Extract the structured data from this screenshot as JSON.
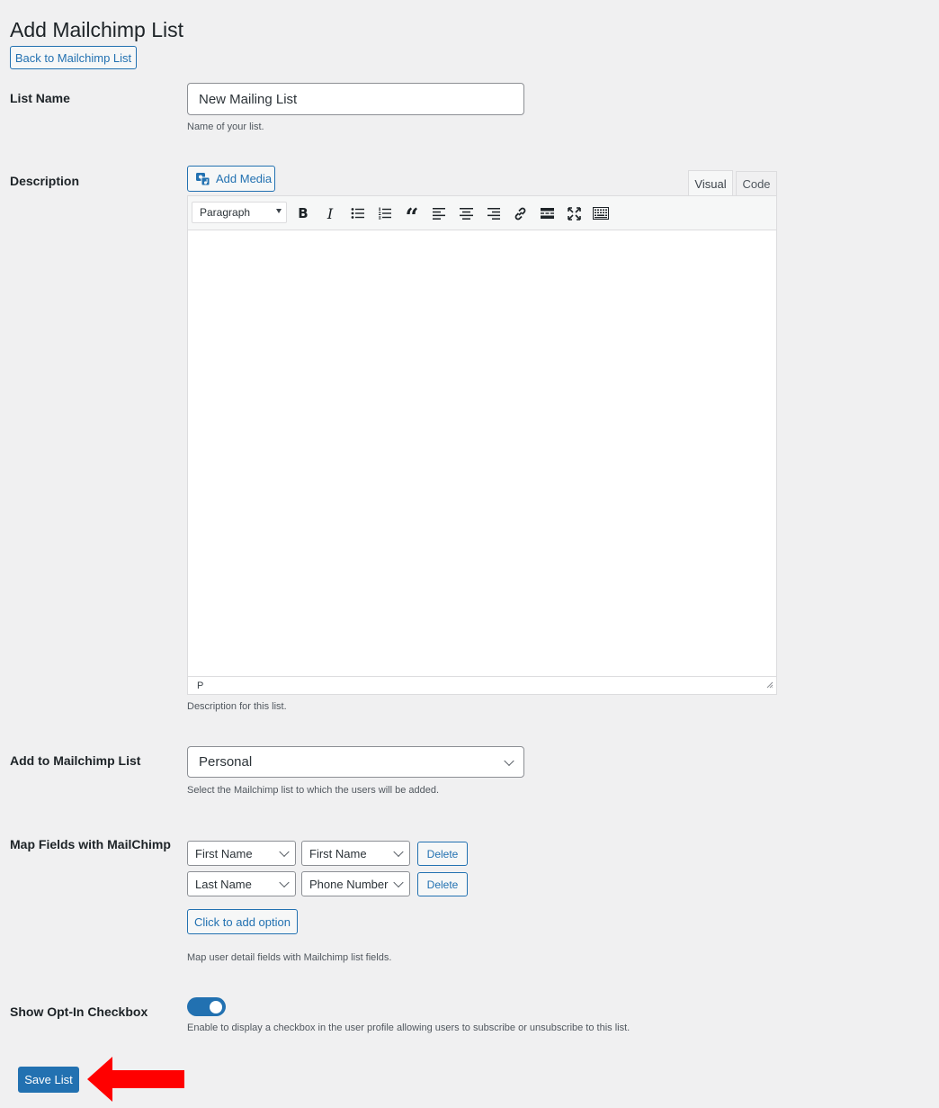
{
  "page": {
    "title": "Add Mailchimp List",
    "back_button": "Back to Mailchimp List"
  },
  "list_name": {
    "label": "List Name",
    "value": "New Mailing List",
    "help": "Name of your list."
  },
  "description": {
    "label": "Description",
    "add_media": "Add Media",
    "tabs": [
      "Visual",
      "Code"
    ],
    "active_tab": "Visual",
    "format_select": "Paragraph",
    "toolbar_icons": [
      "bold-icon",
      "italic-icon",
      "bullet-list-icon",
      "numbered-list-icon",
      "blockquote-icon",
      "align-left-icon",
      "align-center-icon",
      "align-right-icon",
      "link-icon",
      "read-more-icon",
      "fullscreen-icon",
      "toolbar-toggle-icon"
    ],
    "bold_glyph": "B",
    "italic_glyph": "I",
    "quote_glyph": "“",
    "status_path": "P",
    "help": "Description for this list."
  },
  "mailchimp_list": {
    "label": "Add to Mailchimp List",
    "selected": "Personal",
    "help": "Select the Mailchimp list to which the users will be added."
  },
  "map_fields": {
    "label": "Map Fields with MailChimp",
    "rows": [
      {
        "user_field": "First Name",
        "mailchimp_field": "First Name",
        "delete": "Delete"
      },
      {
        "user_field": "Last Name",
        "mailchimp_field": "Phone Number",
        "delete": "Delete"
      }
    ],
    "add_option": "Click to add option",
    "help": "Map user detail fields with Mailchimp list fields."
  },
  "opt_in": {
    "label": "Show Opt-In Checkbox",
    "enabled": true,
    "help": "Enable to display a checkbox in the user profile allowing users to subscribe or unsubscribe to this list."
  },
  "save_button": "Save List",
  "colors": {
    "accent": "#2271b1",
    "background": "#f0f0f1",
    "annotation_arrow": "#ff0000"
  }
}
